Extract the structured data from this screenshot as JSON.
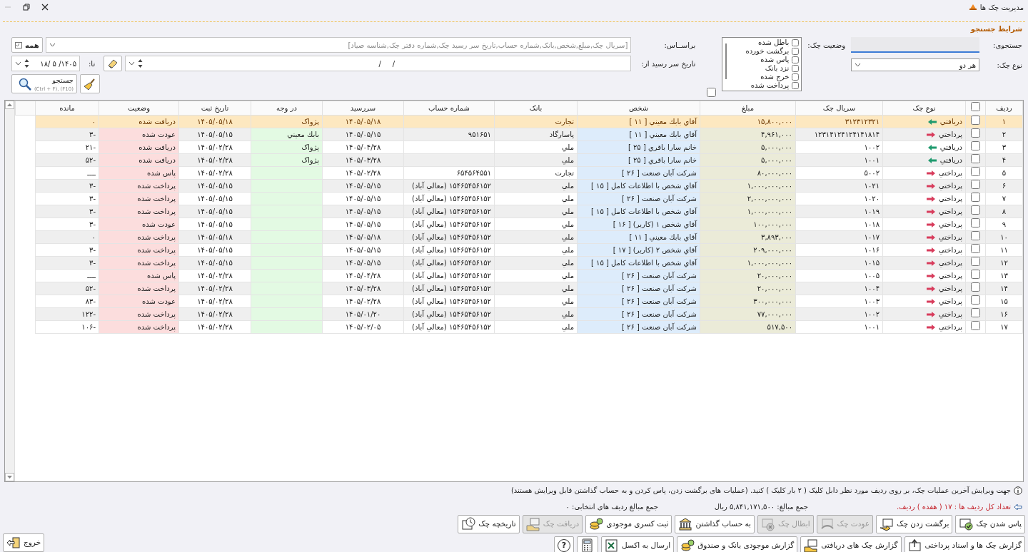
{
  "window": {
    "title": "مدیریت چک ها"
  },
  "search": {
    "title": "شرایط جستجو",
    "query_label": "جستجوی:",
    "type_label": "نوع چک:",
    "type_value": "هر دو",
    "status_label": "وضعیت چک:",
    "statuses": [
      {
        "label": "باطل شده",
        "checked": false
      },
      {
        "label": "برگشت خورده",
        "checked": false
      },
      {
        "label": "پاس شده",
        "checked": false
      },
      {
        "label": "نزد بانک",
        "checked": false
      },
      {
        "label": "خرج شده",
        "checked": false
      },
      {
        "label": "پرداخت شده",
        "checked": false
      }
    ],
    "status_all_checked": false,
    "basis_label": "براســاس:",
    "basis_placeholder": "[سريال چک,مبلغ,شخص,بانک,شماره حساب,تاريخ سر رسيد چک,شماره دفتر چک,شناسه صياد]",
    "all_button": "همه",
    "date_from_label": "تاریخ سر رسید از:",
    "date_from": "/     /",
    "date_to_label": "تا:",
    "date_to": "۱۴۰۵/ ۵ /۱۸",
    "search_button": "جستجو",
    "search_shortcut": "(Ctrl + F), (F10)"
  },
  "table": {
    "header_checked": false,
    "columns": [
      "ردیف",
      "نوع چک",
      "سریال چک",
      "مبلغ",
      "شخص",
      "بانک",
      "شماره حساب",
      "سررسید",
      "در وجه",
      "تاریخ ثبت",
      "وضعیت",
      "مانده"
    ],
    "rows": [
      {
        "no": "۱",
        "kind": "incoming",
        "type": "دریافتي",
        "checked": false,
        "selected": true,
        "serial": "۳۱۲۳۱۲۳۲۱",
        "amount": "۱۵,۸۰۰,۰۰۰",
        "person": "آقاي بابك معيني [ ۱۱ ]",
        "bank": "تجارت",
        "account": "",
        "due": "۱۴۰۵/۰۵/۱۸",
        "payee": "پژواک",
        "registered": "۱۴۰۵/۰۵/۱۸",
        "status": "دریافت شده",
        "remaining": "۰"
      },
      {
        "no": "۲",
        "kind": "outgoing",
        "type": "پرداختي",
        "checked": false,
        "selected": false,
        "serial": "۱۲۳۱۴۱۲۴۱۲۴۱۴۱۸۱۴",
        "amount": "۴,۹۶۱,۰۰۰",
        "person": "آقاي بابك معيني [ ۱۱ ]",
        "bank": "پاسارگاد",
        "account": "۹۵۱۶۵۱",
        "due": "۱۴۰۵/۰۵/۱۵",
        "payee": "بابك معيني",
        "registered": "۱۴۰۵/۰۵/۱۵",
        "status": "عودت شده",
        "remaining": "-۳"
      },
      {
        "no": "۳",
        "kind": "incoming",
        "type": "دریافتي",
        "checked": false,
        "selected": false,
        "serial": "۱۰۰۲",
        "amount": "۵,۰۰۰,۰۰۰",
        "person": "خانم سارا باقري [ ۲۵ ]",
        "bank": "ملي",
        "account": "",
        "due": "۱۴۰۵/۰۴/۲۸",
        "payee": "پژواک",
        "registered": "۱۴۰۵/۰۲/۲۸",
        "status": "دریافت شده",
        "remaining": "-۲۱"
      },
      {
        "no": "۴",
        "kind": "incoming",
        "type": "دریافتي",
        "checked": false,
        "selected": false,
        "serial": "۱۰۰۱",
        "amount": "۵,۰۰۰,۰۰۰",
        "person": "خانم سارا باقري [ ۲۵ ]",
        "bank": "ملي",
        "account": "",
        "due": "۱۴۰۵/۰۳/۲۸",
        "payee": "پژواک",
        "registered": "۱۴۰۵/۰۲/۲۸",
        "status": "دریافت شده",
        "remaining": "-۵۲"
      },
      {
        "no": "۵",
        "kind": "outgoing",
        "type": "پرداختي",
        "checked": false,
        "selected": false,
        "serial": "۵۰۰۲",
        "amount": "۸۰,۰۰۰,۰۰۰",
        "person": "شرکت آبان صنعت  [ ۲۶ ]",
        "bank": "تجارت",
        "account": "۶۵۴۵۶۴۵۵۱",
        "due": "۱۴۰۵/۰۲/۲۸",
        "payee": "",
        "registered": "۱۴۰۵/۰۲/۲۸",
        "status": "پاس شده",
        "remaining": "ــــ"
      },
      {
        "no": "۶",
        "kind": "outgoing",
        "type": "پرداختي",
        "checked": false,
        "selected": false,
        "serial": "۱۰۲۱",
        "amount": "۱,۰۰۰,۰۰۰,۰۰۰",
        "person": "آقاي شخص با اطلاعات کامل [ ۱۵ ]",
        "bank": "ملي",
        "account": "۱۵۴۶۵۴۵۶۱۵۲ (معالي آباد)",
        "due": "۱۴۰۵/۰۵/۱۵",
        "payee": "",
        "registered": "۱۴۰۵/۰۵/۱۵",
        "status": "پرداخت شده",
        "remaining": "-۳"
      },
      {
        "no": "۷",
        "kind": "outgoing",
        "type": "پرداختي",
        "checked": false,
        "selected": false,
        "serial": "۱۰۲۰",
        "amount": "۲,۰۰۰,۰۰۰,۰۰۰",
        "person": "شرکت آبان صنعت  [ ۲۶ ]",
        "bank": "ملي",
        "account": "۱۵۴۶۵۴۵۶۱۵۲ (معالي آباد)",
        "due": "۱۴۰۵/۰۵/۱۵",
        "payee": "",
        "registered": "۱۴۰۵/۰۵/۱۵",
        "status": "پرداخت شده",
        "remaining": "-۳"
      },
      {
        "no": "۸",
        "kind": "outgoing",
        "type": "پرداختي",
        "checked": false,
        "selected": false,
        "serial": "۱۰۱۹",
        "amount": "۱,۰۰۰,۰۰۰,۰۰۰",
        "person": "آقاي شخص با اطلاعات کامل [ ۱۵ ]",
        "bank": "ملي",
        "account": "۱۵۴۶۵۴۵۶۱۵۲ (معالي آباد)",
        "due": "۱۴۰۵/۰۵/۱۵",
        "payee": "",
        "registered": "۱۴۰۵/۰۵/۱۵",
        "status": "پرداخت شده",
        "remaining": "-۳"
      },
      {
        "no": "۹",
        "kind": "outgoing",
        "type": "پرداختي",
        "checked": false,
        "selected": false,
        "serial": "۱۰۱۸",
        "amount": "۱۰۰,۰۰۰,۰۰۰",
        "person": "آقاي شخص ۱ (کاربر)  [ ۱۶ ]",
        "bank": "ملي",
        "account": "۱۵۴۶۵۴۵۶۱۵۲ (معالي آباد)",
        "due": "۱۴۰۵/۰۵/۱۵",
        "payee": "",
        "registered": "۱۴۰۵/۰۵/۱۵",
        "status": "عودت شده",
        "remaining": "-۳"
      },
      {
        "no": "۱۰",
        "kind": "outgoing",
        "type": "پرداختي",
        "checked": false,
        "selected": false,
        "serial": "۱۰۱۷",
        "amount": "۳,۸۹۳,۰۰۰",
        "person": "آقاي بابك معيني [ ۱۱ ]",
        "bank": "ملي",
        "account": "۱۵۴۶۵۴۵۶۱۵۲ (معالي آباد)",
        "due": "۱۴۰۵/۰۵/۱۸",
        "payee": "",
        "registered": "۱۴۰۵/۰۵/۱۸",
        "status": "پرداخت شده",
        "remaining": "۰"
      },
      {
        "no": "۱۱",
        "kind": "outgoing",
        "type": "پرداختي",
        "checked": false,
        "selected": false,
        "serial": "۱۰۱۶",
        "amount": "۲۰۹,۰۰۰,۰۰۰",
        "person": "آقاي شخص ۲ (کاربر)  [ ۱۷ ]",
        "bank": "ملي",
        "account": "۱۵۴۶۵۴۵۶۱۵۲ (معالي آباد)",
        "due": "۱۴۰۵/۰۵/۱۵",
        "payee": "",
        "registered": "۱۴۰۵/۰۵/۱۵",
        "status": "پرداخت شده",
        "remaining": "-۳"
      },
      {
        "no": "۱۲",
        "kind": "outgoing",
        "type": "پرداختي",
        "checked": false,
        "selected": false,
        "serial": "۱۰۱۵",
        "amount": "۱,۰۰۰,۰۰۰,۰۰۰",
        "person": "آقاي شخص با اطلاعات کامل [ ۱۵ ]",
        "bank": "ملي",
        "account": "۱۵۴۶۵۴۵۶۱۵۲ (معالي آباد)",
        "due": "۱۴۰۵/۰۵/۱۵",
        "payee": "",
        "registered": "۱۴۰۵/۰۵/۱۵",
        "status": "پرداخت شده",
        "remaining": "-۳"
      },
      {
        "no": "۱۳",
        "kind": "outgoing",
        "type": "پرداختي",
        "checked": false,
        "selected": false,
        "serial": "۱۰۰۵",
        "amount": "۲۰,۰۰۰,۰۰۰",
        "person": "شرکت آبان صنعت  [ ۲۶ ]",
        "bank": "ملي",
        "account": "۱۵۴۶۵۴۵۶۱۵۲ (معالي آباد)",
        "due": "۱۴۰۵/۰۴/۲۸",
        "payee": "",
        "registered": "۱۴۰۵/۰۲/۲۸",
        "status": "پاس شده",
        "remaining": "ــــ"
      },
      {
        "no": "۱۴",
        "kind": "outgoing",
        "type": "پرداختي",
        "checked": false,
        "selected": false,
        "serial": "۱۰۰۴",
        "amount": "۲۰,۰۰۰,۰۰۰",
        "person": "شرکت آبان صنعت  [ ۲۶ ]",
        "bank": "ملي",
        "account": "۱۵۴۶۵۴۵۶۱۵۲ (معالي آباد)",
        "due": "۱۴۰۵/۰۳/۲۸",
        "payee": "",
        "registered": "۱۴۰۵/۰۲/۲۸",
        "status": "پرداخت شده",
        "remaining": "-۵۲"
      },
      {
        "no": "۱۵",
        "kind": "outgoing",
        "type": "پرداختي",
        "checked": false,
        "selected": false,
        "serial": "۱۰۰۳",
        "amount": "۳۰۰,۰۰۰,۰۰۰",
        "person": "شرکت آبان صنعت  [ ۲۶ ]",
        "bank": "ملي",
        "account": "۱۵۴۶۵۴۵۶۱۵۲ (معالي آباد)",
        "due": "۱۴۰۵/۰۲/۲۸",
        "payee": "",
        "registered": "۱۴۰۵/۰۲/۲۸",
        "status": "عودت شده",
        "remaining": "-۸۳"
      },
      {
        "no": "۱۶",
        "kind": "outgoing",
        "type": "پرداختي",
        "checked": false,
        "selected": false,
        "serial": "۱۰۰۲",
        "amount": "۷۷,۰۰۰,۰۰۰",
        "person": "شرکت آبان صنعت  [ ۲۶ ]",
        "bank": "ملي",
        "account": "۱۵۴۶۵۴۵۶۱۵۲ (معالي آباد)",
        "due": "۱۴۰۵/۰۱/۲۰",
        "payee": "",
        "registered": "۱۴۰۵/۰۲/۲۸",
        "status": "پرداخت شده",
        "remaining": "-۱۲۲"
      },
      {
        "no": "۱۷",
        "kind": "outgoing",
        "type": "پرداختي",
        "checked": false,
        "selected": false,
        "serial": "۱۰۰۱",
        "amount": "۵۱۷,۵۰۰",
        "person": "شرکت آبان صنعت  [ ۲۶ ]",
        "bank": "ملي",
        "account": "۱۵۴۶۵۴۵۶۱۵۲ (معالي آباد)",
        "due": "۱۴۰۵/۰۲/۰۵",
        "payee": "",
        "registered": "۱۴۰۵/۰۲/۲۸",
        "status": "پرداخت شده",
        "remaining": "-۱۰۶"
      }
    ]
  },
  "footer": {
    "hint": "جهت ویرایش آخرین عملیات چک، بر روی ردیف مورد نظر دابل کلیک ( ۲ بار کلیک ) کنید. (عملیات های برگشت زدن، پاس کردن و به حساب گذاشتن قابل ویرایش هستند)",
    "row_count": "تعداد کل ردیف ها : ۱۷ ( هفده ) ردیف.",
    "total": "جمع مبالغ: ۵,۸۴۱,۱۷۱,۵۰۰ ریال",
    "selected_total": "جمع مبالغ ردیف های انتخابی: ۰",
    "actions": [
      {
        "kind": "pass",
        "label": "پاس شدن چک",
        "disabled": false
      },
      {
        "kind": "bounce",
        "label": "برگشت زدن چک",
        "disabled": false
      },
      {
        "kind": "return",
        "label": "عودت چک",
        "disabled": true
      },
      {
        "kind": "void",
        "label": "ابطال چک",
        "disabled": true
      },
      {
        "kind": "deposit",
        "label": "به حساب گذاشتن",
        "disabled": false
      },
      {
        "kind": "shortage",
        "label": "ثبت کسری موجودی",
        "disabled": false
      },
      {
        "kind": "receive",
        "label": "دریافت چک",
        "disabled": true
      },
      {
        "kind": "history",
        "label": "تاریخچه چک",
        "disabled": false
      }
    ],
    "reports": [
      {
        "kind": "report",
        "label": "گزارش چک ها و اسناد پرداختی",
        "disabled": false
      },
      {
        "kind": "receive",
        "label": "گزارش چک های دریافتی",
        "disabled": false
      },
      {
        "kind": "shortage",
        "label": "گزارش موجودی بانک و صندوق",
        "disabled": false
      },
      {
        "kind": "excel",
        "label": "ارسال به اکسل",
        "disabled": false
      },
      {
        "kind": "calculator",
        "disabled": false
      },
      {
        "kind": "help",
        "label": "?",
        "disabled": false
      }
    ],
    "exit_button": "خروج"
  }
}
